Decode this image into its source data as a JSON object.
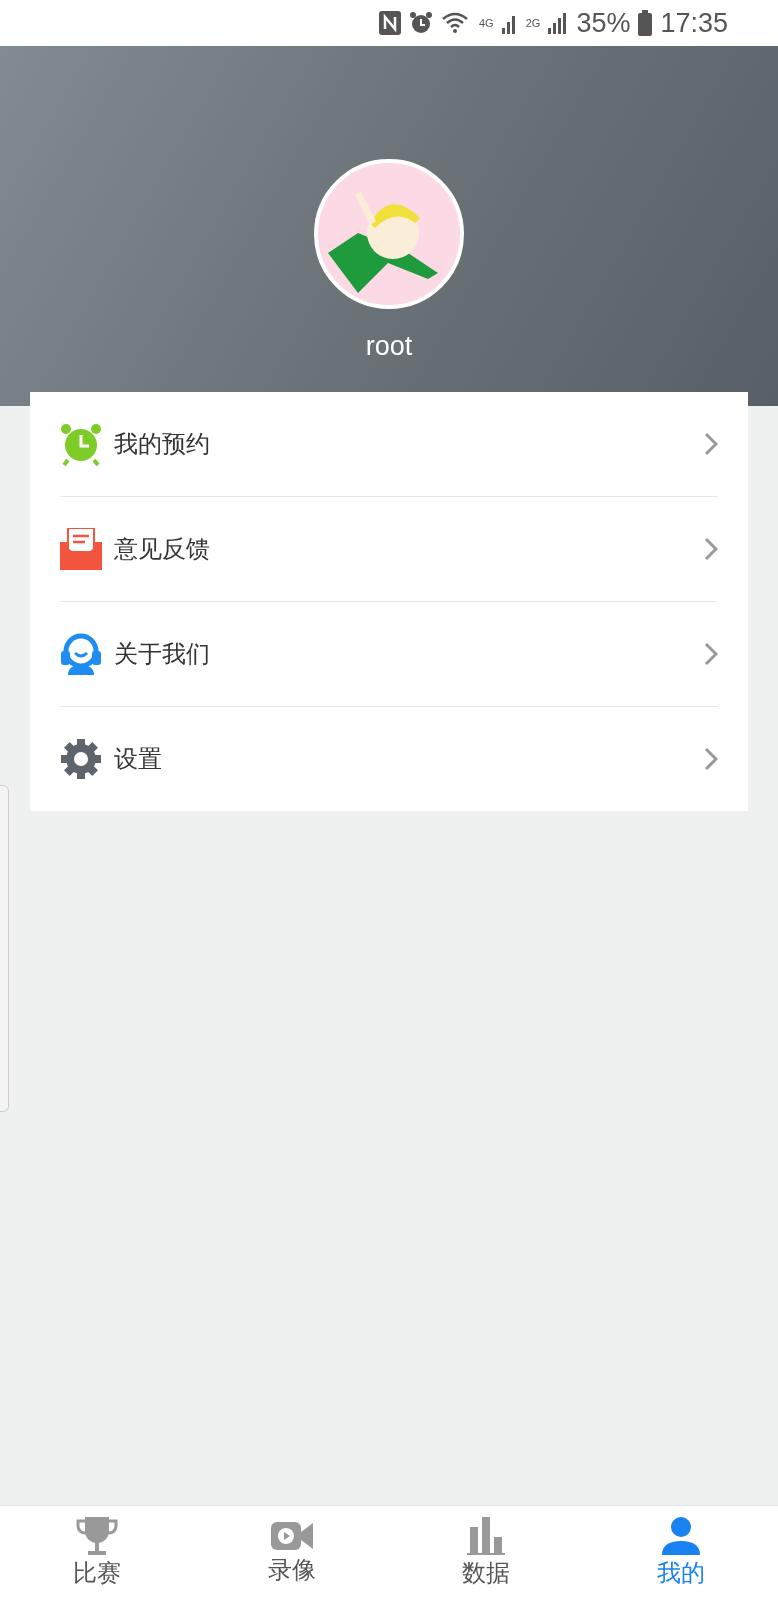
{
  "status_bar": {
    "network_1": "4G",
    "network_2": "2G",
    "battery": "35%",
    "time": "17:35"
  },
  "profile": {
    "username": "root"
  },
  "menu": [
    {
      "kind": "alarm",
      "label": "我的预约"
    },
    {
      "kind": "mail",
      "label": "意见反馈"
    },
    {
      "kind": "support",
      "label": "关于我们"
    },
    {
      "kind": "gear",
      "label": "设置"
    }
  ],
  "tabs": [
    {
      "kind": "trophy",
      "label": "比赛",
      "selected": false
    },
    {
      "kind": "video",
      "label": "录像",
      "selected": false
    },
    {
      "kind": "chart",
      "label": "数据",
      "selected": false
    },
    {
      "kind": "person",
      "label": "我的",
      "selected": true
    }
  ]
}
